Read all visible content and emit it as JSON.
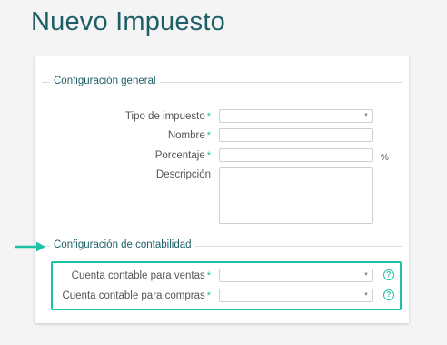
{
  "page": {
    "title": "Nuevo Impuesto"
  },
  "general": {
    "legend": "Configuración general",
    "tax_type": {
      "label": "Tipo de impuesto",
      "value": ""
    },
    "name": {
      "label": "Nombre",
      "value": ""
    },
    "percentage": {
      "label": "Porcentaje",
      "value": "",
      "unit": "%"
    },
    "description": {
      "label": "Descripción",
      "value": ""
    }
  },
  "accounting": {
    "legend": "Configuración de contabilidad",
    "sales_account": {
      "label": "Cuenta contable para ventas",
      "value": ""
    },
    "purchase_account": {
      "label": "Cuenta contable para compras",
      "value": ""
    }
  },
  "icons": {
    "required": "*",
    "help": "?",
    "dropdown": "▼"
  },
  "colors": {
    "title": "#1e5f67",
    "accent": "#1fc1a6"
  }
}
